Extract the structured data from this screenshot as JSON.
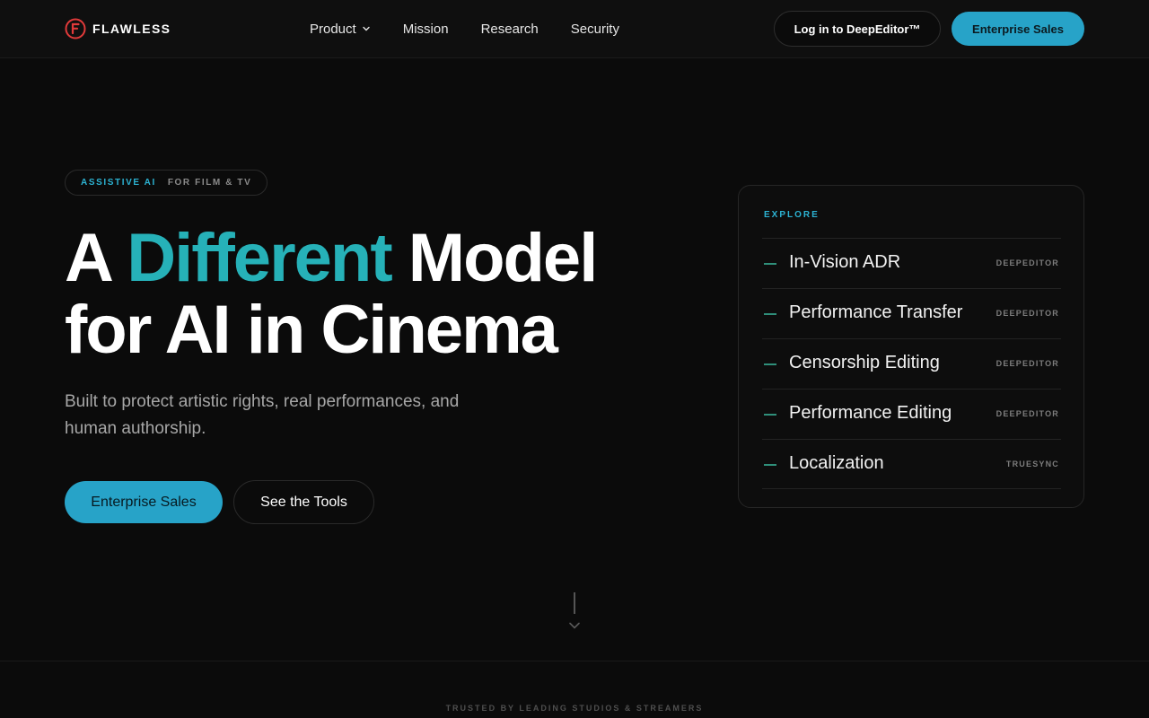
{
  "nav": {
    "brand": "FLAWLESS",
    "links": [
      {
        "label": "Product"
      },
      {
        "label": "Mission"
      },
      {
        "label": "Research"
      },
      {
        "label": "Security"
      }
    ],
    "login_label": "Log in to DeepEditor™",
    "enterprise_label": "Enterprise Sales"
  },
  "hero": {
    "tag_primary": "ASSISTIVE AI",
    "tag_secondary": "FOR FILM & TV",
    "headline_part1": "A ",
    "headline_accent": "Different",
    "headline_part2": " Model",
    "headline_line2": "for AI in Cinema",
    "subtitle": "Built to protect artistic rights, real performances, and human authorship.",
    "cta_primary": "Enterprise Sales",
    "cta_secondary": "See the Tools"
  },
  "explore": {
    "title": "EXPLORE",
    "items": [
      {
        "label": "In-Vision ADR",
        "tag": "DEEPEDITOR"
      },
      {
        "label": "Performance Transfer",
        "tag": "DEEPEDITOR"
      },
      {
        "label": "Censorship Editing",
        "tag": "DEEPEDITOR"
      },
      {
        "label": "Performance Editing",
        "tag": "DEEPEDITOR"
      },
      {
        "label": "Localization",
        "tag": "TRUESYNC"
      }
    ]
  },
  "footer": {
    "trusted": "TRUSTED BY LEADING STUDIOS & STREAMERS"
  },
  "colors": {
    "background": "#0b0b0b",
    "accent_blue": "#27a3c8",
    "accent_teal": "#26b1b8",
    "dash_green": "#2f8f7a"
  },
  "icons": {
    "logo": "flawless-logo-icon",
    "product_dropdown": "chevron-down-icon",
    "scroll": "chevron-down-icon"
  }
}
